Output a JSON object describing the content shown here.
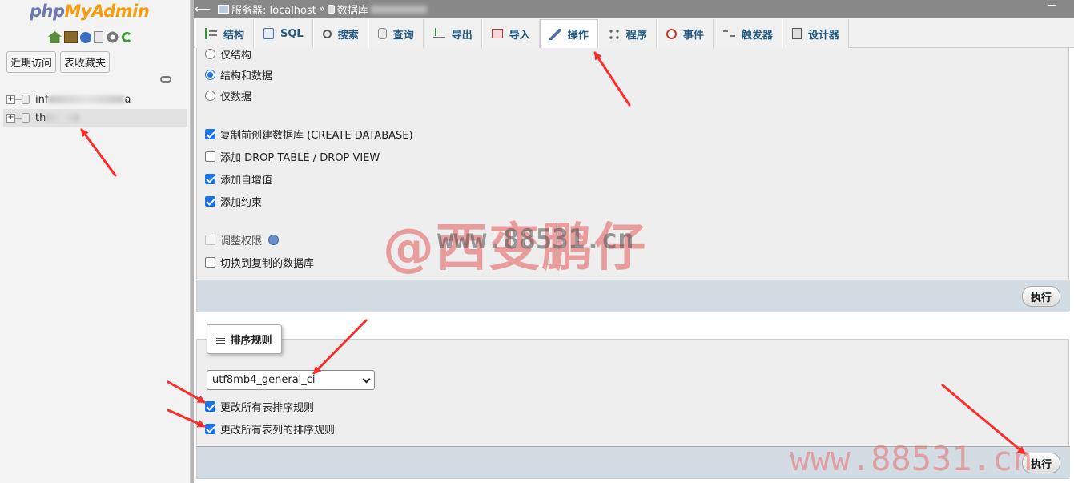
{
  "nav": {
    "logo_php": "php",
    "logo_myadmin": "MyAdmin",
    "recent_btn": "近期访问",
    "favorites_btn": "表收藏夹",
    "databases": [
      {
        "prefix": "inf",
        "suffix": "a"
      },
      {
        "prefix": "th",
        "suffix": ""
      }
    ]
  },
  "topbar": {
    "server": "服务器: localhost",
    "separator": "»",
    "db_label": "数据库"
  },
  "tabs": [
    {
      "label": "结构",
      "icon": "structure-icon"
    },
    {
      "label": "SQL",
      "icon": "sql-icon"
    },
    {
      "label": "搜索",
      "icon": "search-icon"
    },
    {
      "label": "查询",
      "icon": "query-icon"
    },
    {
      "label": "导出",
      "icon": "export-icon"
    },
    {
      "label": "导入",
      "icon": "import-icon"
    },
    {
      "label": "操作",
      "icon": "wrench-icon",
      "active": true
    },
    {
      "label": "程序",
      "icon": "routines-icon"
    },
    {
      "label": "事件",
      "icon": "clock-icon"
    },
    {
      "label": "触发器",
      "icon": "triggers-icon"
    },
    {
      "label": "设计器",
      "icon": "designer-icon"
    }
  ],
  "copy_db": {
    "radio_structure_only": "仅结构",
    "radio_structure_data": "结构和数据",
    "radio_data_only": "仅数据",
    "chk_create_db": "复制前创建数据库 (CREATE DATABASE)",
    "chk_drop_table": "添加 DROP TABLE / DROP VIEW",
    "chk_auto_increment": "添加自增值",
    "chk_constraints": "添加约束",
    "chk_adjust_privileges": "调整权限",
    "chk_switch_db": "切换到复制的数据库",
    "go_label": "执行"
  },
  "collation": {
    "legend": "排序规则",
    "selected": "utf8mb4_general_ci",
    "chk_change_tables": "更改所有表排序规则",
    "chk_change_columns": "更改所有表列的排序规则",
    "go_label": "执行"
  },
  "watermarks": {
    "main_text": "@西变鹏仔",
    "main_url": "www.88531.cn",
    "bottom_url": "www.88531.cn"
  },
  "colors": {
    "link": "#235a81",
    "checkbox": "#1a73e8",
    "arrow": "#ff2a2a"
  }
}
